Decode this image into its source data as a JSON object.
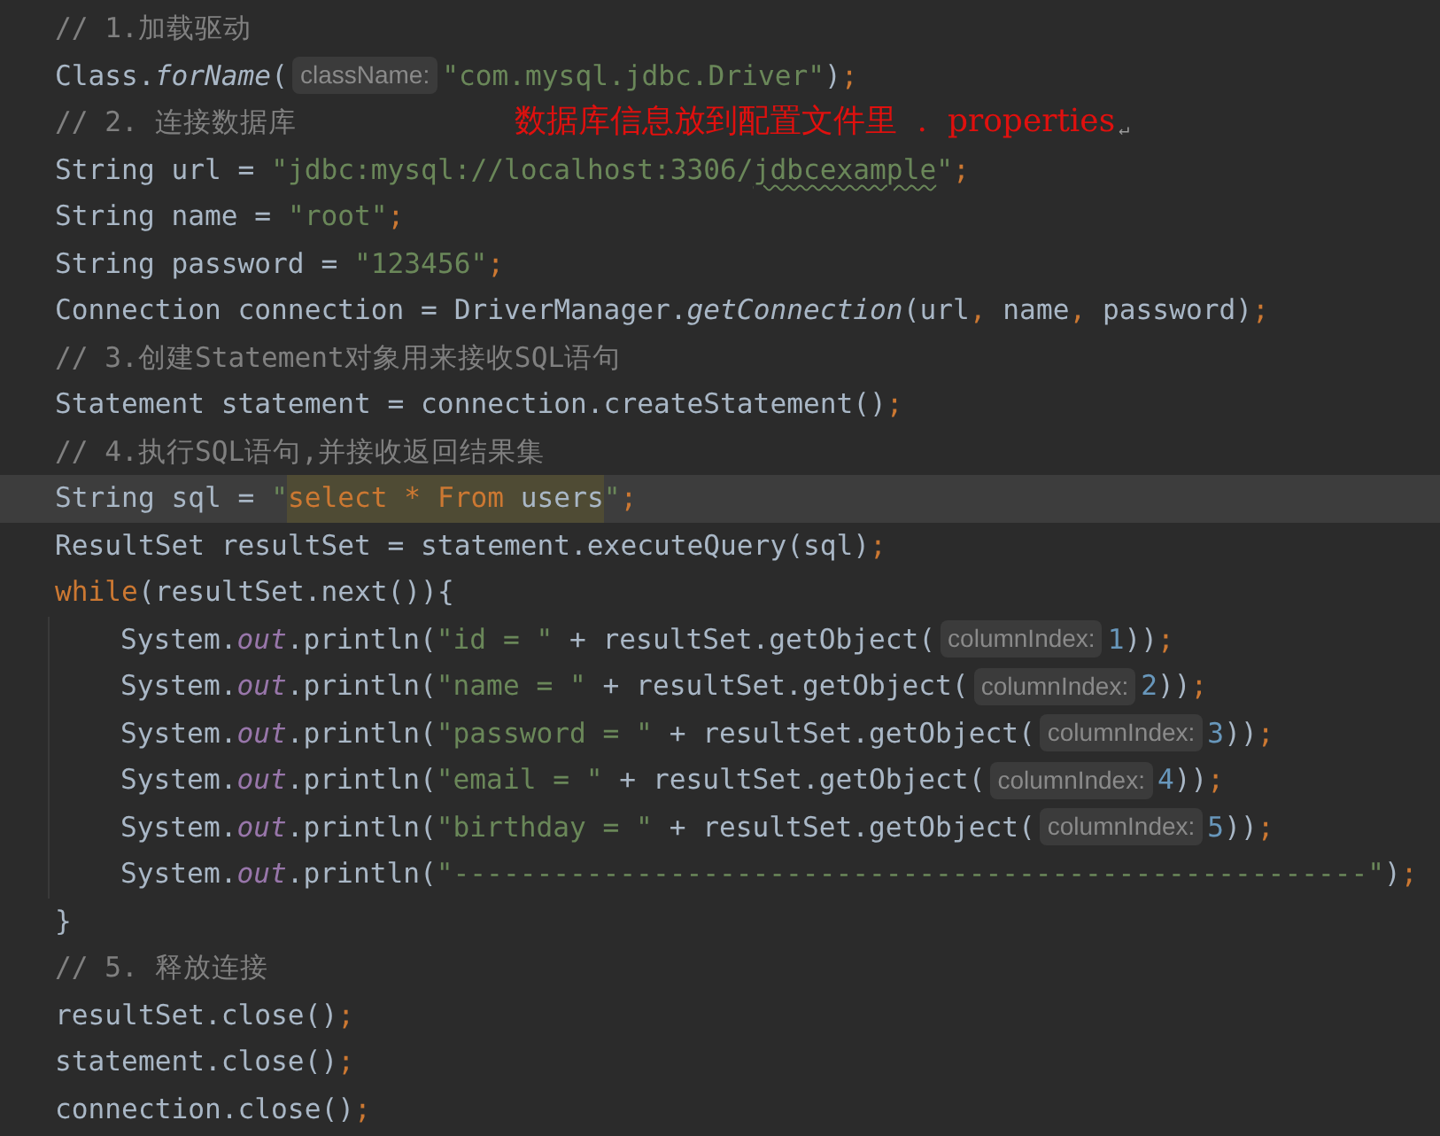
{
  "editor": {
    "lines": [
      {
        "current": false,
        "tokens": [
          {
            "kind": "comment",
            "text": "// 1.加载驱动"
          }
        ]
      },
      {
        "current": false,
        "tokens": [
          {
            "kind": "plain",
            "text": "Class."
          },
          {
            "kind": "method",
            "text": "forName"
          },
          {
            "kind": "plain",
            "text": "("
          },
          {
            "kind": "hint",
            "text": "className:"
          },
          {
            "kind": "string",
            "text": "\"com.mysql.jdbc.Driver\""
          },
          {
            "kind": "plain",
            "text": ")"
          },
          {
            "kind": "punct",
            "text": ";"
          }
        ]
      },
      {
        "current": false,
        "tokens": [
          {
            "kind": "comment",
            "text": "// 2. 连接数据库"
          }
        ],
        "annotation": {
          "text": "数据库信息放到配置文件里  .  properties",
          "mark": "↵"
        }
      },
      {
        "current": false,
        "tokens": [
          {
            "kind": "plain",
            "text": "String url = "
          },
          {
            "kind": "string",
            "text": "\"jdbc:mysql://localhost:3306/"
          },
          {
            "kind": "typo",
            "text": "jdbcexample"
          },
          {
            "kind": "string",
            "text": "\""
          },
          {
            "kind": "punct",
            "text": ";"
          }
        ]
      },
      {
        "current": false,
        "tokens": [
          {
            "kind": "plain",
            "text": "String name = "
          },
          {
            "kind": "string",
            "text": "\"root\""
          },
          {
            "kind": "punct",
            "text": ";"
          }
        ]
      },
      {
        "current": false,
        "tokens": [
          {
            "kind": "plain",
            "text": "String password = "
          },
          {
            "kind": "string",
            "text": "\"123456\""
          },
          {
            "kind": "punct",
            "text": ";"
          }
        ]
      },
      {
        "current": false,
        "tokens": [
          {
            "kind": "plain",
            "text": "Connection connection = DriverManager."
          },
          {
            "kind": "method",
            "text": "getConnection"
          },
          {
            "kind": "plain",
            "text": "(url"
          },
          {
            "kind": "punct",
            "text": ", "
          },
          {
            "kind": "plain",
            "text": "name"
          },
          {
            "kind": "punct",
            "text": ", "
          },
          {
            "kind": "plain",
            "text": "password)"
          },
          {
            "kind": "punct",
            "text": ";"
          }
        ]
      },
      {
        "current": false,
        "tokens": [
          {
            "kind": "comment",
            "text": "// 3.创建Statement对象用来接收SQL语句"
          }
        ]
      },
      {
        "current": false,
        "tokens": [
          {
            "kind": "plain",
            "text": "Statement statement = connection.createStatement()"
          },
          {
            "kind": "punct",
            "text": ";"
          }
        ]
      },
      {
        "current": false,
        "tokens": [
          {
            "kind": "comment",
            "text": "// 4.执行SQL语句,并接收返回结果集"
          }
        ]
      },
      {
        "current": true,
        "tokens": [
          {
            "kind": "plain",
            "text": "String sql = "
          },
          {
            "kind": "string",
            "text": "\""
          },
          {
            "kind": "sel-keyword",
            "text": "select * From"
          },
          {
            "kind": "sel-plain",
            "text": " users"
          },
          {
            "kind": "string",
            "text": "\""
          },
          {
            "kind": "punct",
            "text": ";"
          }
        ]
      },
      {
        "current": false,
        "tokens": [
          {
            "kind": "plain",
            "text": "ResultSet resultSet = statement.executeQuery(sql)"
          },
          {
            "kind": "punct",
            "text": ";"
          }
        ]
      },
      {
        "current": false,
        "tokens": [
          {
            "kind": "keyword",
            "text": "while"
          },
          {
            "kind": "plain",
            "text": "(resultSet.next()){"
          }
        ],
        "children": [
          {
            "current": false,
            "tokens": [
              {
                "kind": "plain",
                "text": "System."
              },
              {
                "kind": "field",
                "text": "out"
              },
              {
                "kind": "plain",
                "text": ".println("
              },
              {
                "kind": "string",
                "text": "\"id = \""
              },
              {
                "kind": "plain",
                "text": " + resultSet.getObject("
              },
              {
                "kind": "hint",
                "text": "columnIndex:"
              },
              {
                "kind": "number",
                "text": "1"
              },
              {
                "kind": "plain",
                "text": "))"
              },
              {
                "kind": "punct",
                "text": ";"
              }
            ]
          },
          {
            "current": false,
            "tokens": [
              {
                "kind": "plain",
                "text": "System."
              },
              {
                "kind": "field",
                "text": "out"
              },
              {
                "kind": "plain",
                "text": ".println("
              },
              {
                "kind": "string",
                "text": "\"name = \""
              },
              {
                "kind": "plain",
                "text": " + resultSet.getObject("
              },
              {
                "kind": "hint",
                "text": "columnIndex:"
              },
              {
                "kind": "number",
                "text": "2"
              },
              {
                "kind": "plain",
                "text": "))"
              },
              {
                "kind": "punct",
                "text": ";"
              }
            ]
          },
          {
            "current": false,
            "tokens": [
              {
                "kind": "plain",
                "text": "System."
              },
              {
                "kind": "field",
                "text": "out"
              },
              {
                "kind": "plain",
                "text": ".println("
              },
              {
                "kind": "string",
                "text": "\"password = \""
              },
              {
                "kind": "plain",
                "text": " + resultSet.getObject("
              },
              {
                "kind": "hint",
                "text": "columnIndex:"
              },
              {
                "kind": "number",
                "text": "3"
              },
              {
                "kind": "plain",
                "text": "))"
              },
              {
                "kind": "punct",
                "text": ";"
              }
            ]
          },
          {
            "current": false,
            "tokens": [
              {
                "kind": "plain",
                "text": "System."
              },
              {
                "kind": "field",
                "text": "out"
              },
              {
                "kind": "plain",
                "text": ".println("
              },
              {
                "kind": "string",
                "text": "\"email = \""
              },
              {
                "kind": "plain",
                "text": " + resultSet.getObject("
              },
              {
                "kind": "hint",
                "text": "columnIndex:"
              },
              {
                "kind": "number",
                "text": "4"
              },
              {
                "kind": "plain",
                "text": "))"
              },
              {
                "kind": "punct",
                "text": ";"
              }
            ]
          },
          {
            "current": false,
            "tokens": [
              {
                "kind": "plain",
                "text": "System."
              },
              {
                "kind": "field",
                "text": "out"
              },
              {
                "kind": "plain",
                "text": ".println("
              },
              {
                "kind": "string",
                "text": "\"birthday = \""
              },
              {
                "kind": "plain",
                "text": " + resultSet.getObject("
              },
              {
                "kind": "hint",
                "text": "columnIndex:"
              },
              {
                "kind": "number",
                "text": "5"
              },
              {
                "kind": "plain",
                "text": "))"
              },
              {
                "kind": "punct",
                "text": ";"
              }
            ]
          },
          {
            "current": false,
            "tokens": [
              {
                "kind": "plain",
                "text": "System."
              },
              {
                "kind": "field",
                "text": "out"
              },
              {
                "kind": "plain",
                "text": ".println("
              },
              {
                "kind": "string",
                "text": "\"-------------------------------------------------------\""
              },
              {
                "kind": "plain",
                "text": ")"
              },
              {
                "kind": "punct",
                "text": ";"
              }
            ]
          }
        ]
      },
      {
        "current": false,
        "tokens": [
          {
            "kind": "plain",
            "text": "}"
          }
        ]
      },
      {
        "current": false,
        "tokens": [
          {
            "kind": "comment",
            "text": "// 5. 释放连接"
          }
        ]
      },
      {
        "current": false,
        "tokens": [
          {
            "kind": "plain",
            "text": "resultSet.close()"
          },
          {
            "kind": "punct",
            "text": ";"
          }
        ]
      },
      {
        "current": false,
        "tokens": [
          {
            "kind": "plain",
            "text": "statement.close()"
          },
          {
            "kind": "punct",
            "text": ";"
          }
        ]
      },
      {
        "current": false,
        "tokens": [
          {
            "kind": "plain",
            "text": "connection.close()"
          },
          {
            "kind": "punct",
            "text": ";"
          }
        ]
      }
    ]
  }
}
